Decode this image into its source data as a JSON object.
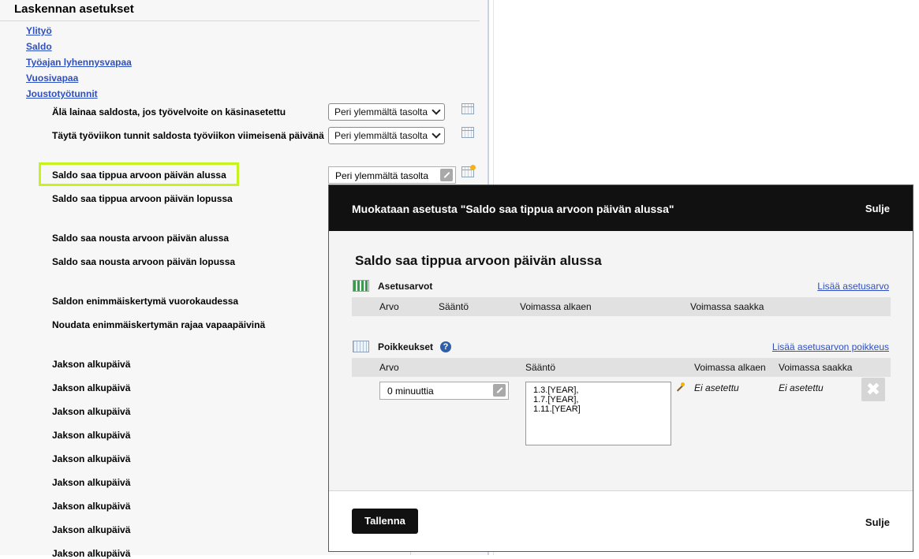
{
  "panel": {
    "title": "Laskennan asetukset",
    "nav_links": [
      "Ylityö",
      "Saldo",
      "Työajan lyhennysvapaa",
      "Vuosivapaa",
      "Joustotyötunnit"
    ],
    "settings": [
      "Älä lainaa saldosta, jos työvelvoite on käsinasetettu",
      "Täytä työviikon tunnit saldosta työviikon viimeisenä päivänä",
      "Saldo saa tippua arvoon päivän alussa",
      "Saldo saa tippua arvoon päivän lopussa",
      "Saldo saa nousta arvoon päivän alussa",
      "Saldo saa nousta arvoon päivän lopussa",
      "Saldon enimmäiskertymä vuorokaudessa",
      "Noudata enimmäiskertymän rajaa vapaapäivinä",
      "Jakson alkupäivä",
      "Jakson alkupäivä",
      "Jakson alkupäivä",
      "Jakson alkupäivä",
      "Jakson alkupäivä",
      "Jakson alkupäivä",
      "Jakson alkupäivä",
      "Jakson alkupäivä",
      "Jakson alkupäivä"
    ],
    "select_value_1": "Peri ylemmältä tasolta",
    "select_value_2": "Peri ylemmältä tasolta",
    "text_value_3": "Peri ylemmältä tasolta"
  },
  "modal": {
    "title": "Muokataan asetusta \"Saldo saa tippua arvoon päivän alussa\"",
    "close_label": "Sulje",
    "heading": "Saldo saa tippua arvoon päivän alussa",
    "values_section": {
      "title": "Asetusarvot",
      "add_link": "Lisää asetusarvo",
      "columns": [
        "Arvo",
        "Sääntö",
        "Voimassa alkaen",
        "Voimassa saakka"
      ]
    },
    "exceptions_section": {
      "title": "Poikkeukset",
      "help": "?",
      "add_link": "Lisää asetusarvon poikkeus",
      "columns": [
        "Arvo",
        "Sääntö",
        "Voimassa alkaen",
        "Voimassa saakka"
      ],
      "row": {
        "value": "0 minuuttia",
        "rule_lines": [
          "1.3.[YEAR],",
          "1.7.[YEAR],",
          "1.11.[YEAR]"
        ],
        "valid_from": "Ei asetettu",
        "valid_to": "Ei asetettu",
        "delete_glyph": "✖"
      }
    },
    "save_label": "Tallenna",
    "close_bottom_label": "Sulje"
  }
}
